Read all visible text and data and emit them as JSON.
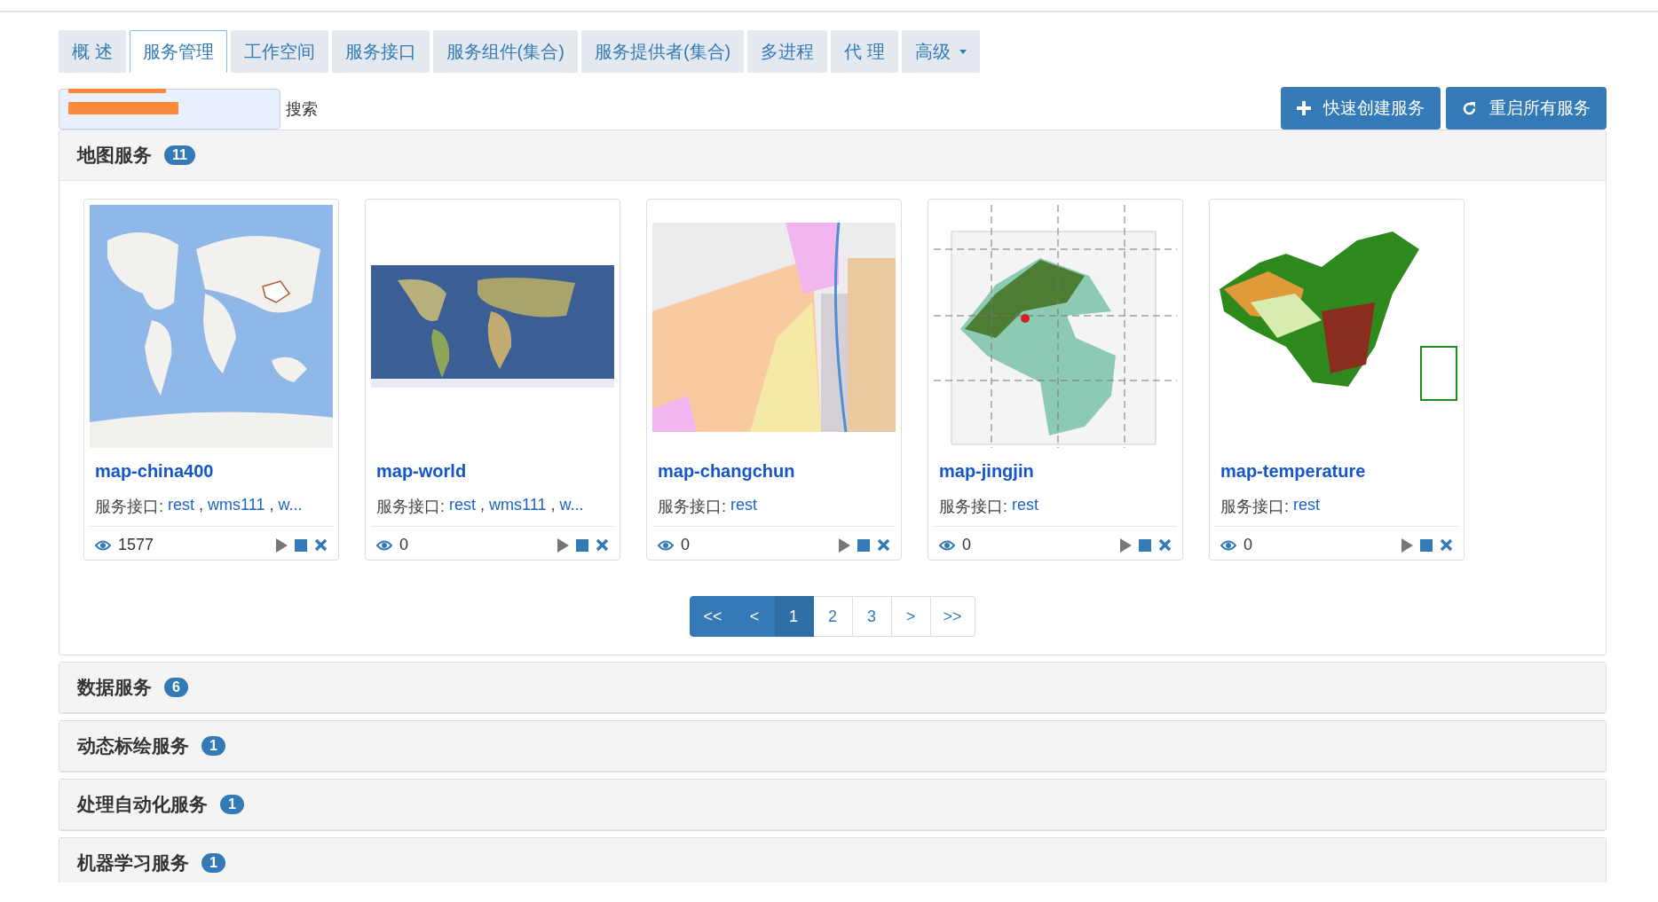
{
  "tabs": [
    {
      "label": "概 述",
      "selected": false
    },
    {
      "label": "服务管理",
      "selected": true
    },
    {
      "label": "工作空间",
      "selected": false
    },
    {
      "label": "服务接口",
      "selected": false
    },
    {
      "label": "服务组件(集合)",
      "selected": false
    },
    {
      "label": "服务提供者(集合)",
      "selected": false
    },
    {
      "label": "多进程",
      "selected": false
    },
    {
      "label": "代 理",
      "selected": false
    },
    {
      "label": "高级",
      "selected": false,
      "dropdown": true
    }
  ],
  "search": {
    "redacted": true,
    "button": "搜索"
  },
  "actions": [
    {
      "kind": "create",
      "label": "快速创建服务"
    },
    {
      "kind": "restart",
      "label": "重启所有服务"
    }
  ],
  "separator": ",",
  "groups": [
    {
      "title": "地图服务",
      "count": "11",
      "expanded": true,
      "cards": [
        {
          "name": "map-china400",
          "interface_label": "服务接口:",
          "interfaces": [
            "rest",
            "wms111",
            "w..."
          ],
          "views": "1577"
        },
        {
          "name": "map-world",
          "interface_label": "服务接口:",
          "interfaces": [
            "rest",
            "wms111",
            "w..."
          ],
          "views": "0"
        },
        {
          "name": "map-changchun",
          "interface_label": "服务接口:",
          "interfaces": [
            "rest"
          ],
          "views": "0"
        },
        {
          "name": "map-jingjin",
          "interface_label": "服务接口:",
          "interfaces": [
            "rest"
          ],
          "views": "0"
        },
        {
          "name": "map-temperature",
          "interface_label": "服务接口:",
          "interfaces": [
            "rest"
          ],
          "views": "0"
        }
      ],
      "pagination": [
        {
          "label": "<<",
          "selected": false,
          "disabled": true
        },
        {
          "label": "<",
          "selected": false,
          "disabled": true
        },
        {
          "label": "1",
          "selected": true,
          "disabled": false
        },
        {
          "label": "2",
          "selected": false,
          "disabled": false
        },
        {
          "label": "3",
          "selected": false,
          "disabled": false
        },
        {
          "label": ">",
          "selected": false,
          "disabled": false
        },
        {
          "label": ">>",
          "selected": false,
          "disabled": false
        }
      ]
    },
    {
      "title": "数据服务",
      "count": "6",
      "expanded": false
    },
    {
      "title": "动态标绘服务",
      "count": "1",
      "expanded": false
    },
    {
      "title": "处理自动化服务",
      "count": "1",
      "expanded": false
    },
    {
      "title": "机器学习服务",
      "count": "1",
      "expanded": false
    }
  ]
}
